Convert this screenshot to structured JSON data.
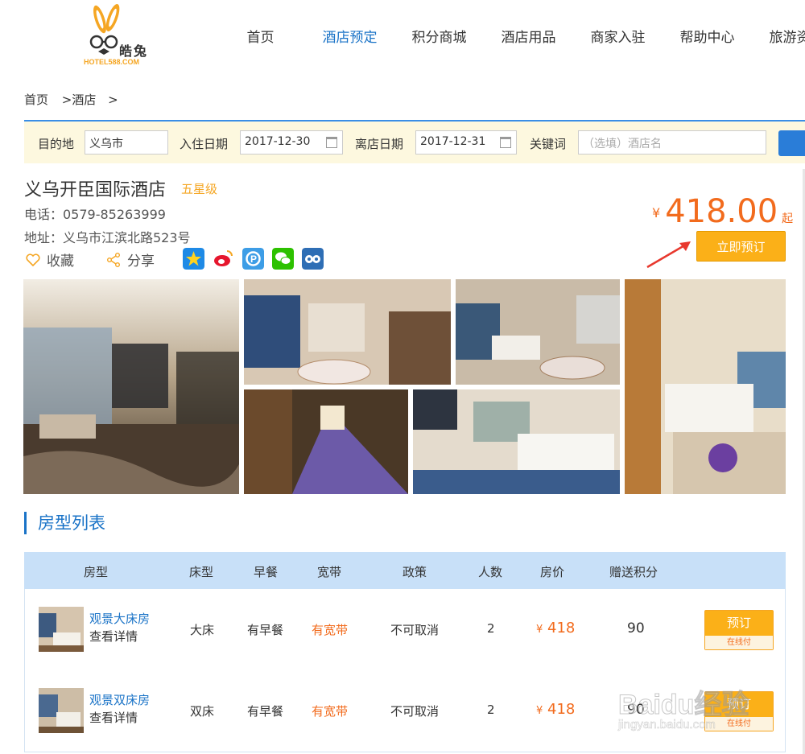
{
  "header": {
    "logo_text": "皓兔",
    "logo_sub": "HOTEL588.COM",
    "nav": [
      "首页",
      "酒店预定",
      "积分商城",
      "酒店用品",
      "商家入驻",
      "帮助中心",
      "旅游资讯"
    ],
    "active_nav": "酒店预定"
  },
  "breadcrumb": [
    "首页",
    ">酒店",
    ">"
  ],
  "search": {
    "dest_label": "目的地",
    "dest_value": "义乌市",
    "checkin_label": "入住日期",
    "checkin_value": "2017-12-30",
    "checkout_label": "离店日期",
    "checkout_value": "2017-12-31",
    "keyword_label": "关键词",
    "keyword_placeholder": "（选填）酒店名"
  },
  "hotel": {
    "name": "义乌开臣国际酒店",
    "star": "五星级",
    "phone": "电话：0579-85263999",
    "address": "地址：义乌市江滨北路523号",
    "fav": "收藏",
    "share": "分享",
    "price_symbol": "¥",
    "price": "418.00",
    "price_suffix": "起",
    "book_label": "立即预订"
  },
  "colors": {
    "accent": "#1a73c7",
    "price": "#f26b1d",
    "button": "#fbb018",
    "search_bg": "#fdf8df",
    "table_head": "#c8e0f8"
  },
  "rooms_section": {
    "title": "房型列表",
    "headers": [
      "房型",
      "床型",
      "早餐",
      "宽带",
      "政策",
      "人数",
      "房价",
      "赠送积分"
    ],
    "rows": [
      {
        "name": "观景大床房",
        "detail": "查看详情",
        "bed": "大床",
        "breakfast": "有早餐",
        "broadband": "有宽带",
        "policy": "不可取消",
        "people": "2",
        "price_symbol": "¥",
        "price": "418",
        "points": "90",
        "book": "预订",
        "pay": "在线付"
      },
      {
        "name": "观景双床房",
        "detail": "查看详情",
        "bed": "双床",
        "breakfast": "有早餐",
        "broadband": "有宽带",
        "policy": "不可取消",
        "people": "2",
        "price_symbol": "¥",
        "price": "418",
        "points": "90",
        "book": "预订",
        "pay": "在线付"
      }
    ]
  },
  "watermark": {
    "main": "Baidu经验",
    "sub": "jingyan.baidu.com"
  }
}
